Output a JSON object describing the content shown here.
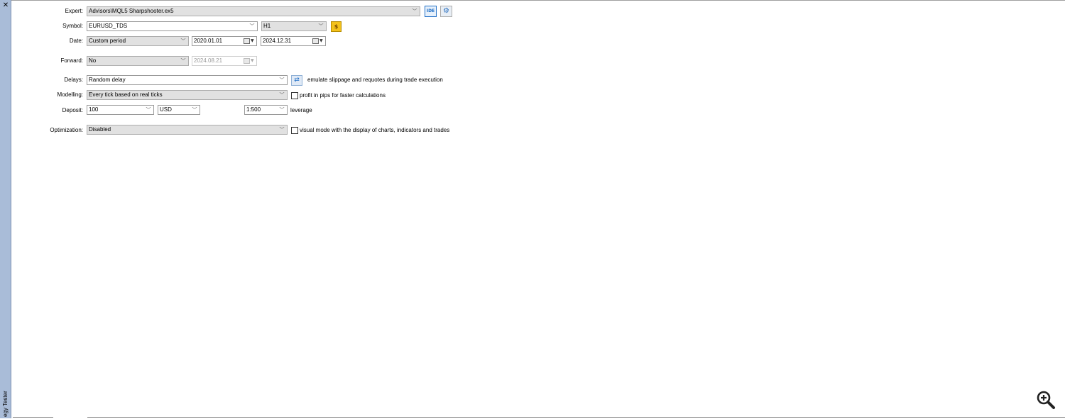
{
  "window": {
    "title": "Strategy Tester",
    "title_visible": "egy Tester"
  },
  "icons": {
    "close": "close-icon",
    "ide": "ide-icon",
    "settings": "gear-icon",
    "symbol_props": "dollar-icon",
    "delays_settings": "sliders-icon",
    "zoom": "zoom-in-icon"
  },
  "settings": {
    "expert": {
      "label": "Expert:",
      "value": "Advisors\\MQL5 Sharpshooter.ex5",
      "ide_label": "IDE"
    },
    "symbol": {
      "label": "Symbol:",
      "value": "EURUSD_TDS",
      "timeframe": "H1"
    },
    "date": {
      "label": "Date:",
      "period": "Custom period",
      "from": "2020.01.01",
      "to": "2024.12.31"
    },
    "forward": {
      "label": "Forward:",
      "value": "No",
      "date": "2024.08.21"
    },
    "delays": {
      "label": "Delays:",
      "value": "Random delay",
      "note": "emulate slippage and requotes during trade execution"
    },
    "modelling": {
      "label": "Modelling:",
      "value": "Every tick based on real ticks",
      "checkbox_label": "profit in pips for faster calculations",
      "checked": false
    },
    "deposit": {
      "label": "Deposit:",
      "amount": "100",
      "currency": "USD",
      "leverage": "1:500",
      "leverage_label": "leverage"
    },
    "optimization": {
      "label": "Optimization:",
      "value": "Disabled",
      "checkbox_label": "visual mode with the display of charts, indicators and trades",
      "checked": false
    }
  },
  "colors": {
    "sidebar": "#a9bcd8",
    "accent": "#1f6ec6",
    "dollar": "#f4c21b"
  }
}
